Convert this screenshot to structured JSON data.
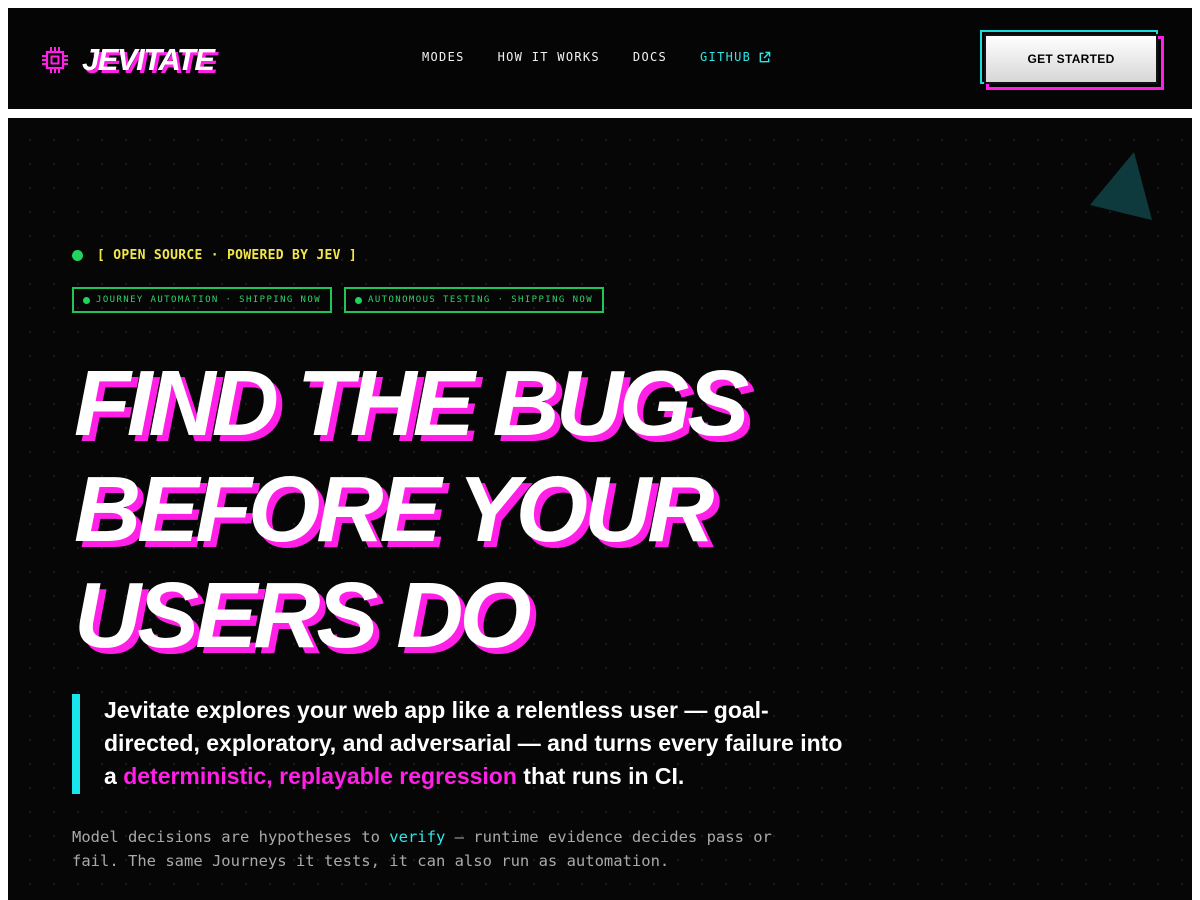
{
  "nav": {
    "logo_text": "JEVITATE",
    "logo_icon": "chip-icon",
    "links": [
      {
        "label": "MODES"
      },
      {
        "label": "HOW IT WORKS"
      },
      {
        "label": "DOCS"
      },
      {
        "label": "GITHUB",
        "icon": "external-link-icon"
      }
    ],
    "cta_label": "GET STARTED"
  },
  "hero": {
    "eyebrow": "[ OPEN SOURCE · POWERED BY JEV ]",
    "badges": [
      {
        "label": "JOURNEY AUTOMATION · SHIPPING NOW"
      },
      {
        "label": "AUTONOMOUS TESTING · SHIPPING NOW"
      }
    ],
    "headline": [
      "FIND THE BUGS",
      "BEFORE YOUR",
      "USERS DO"
    ],
    "lede": {
      "before": "Jevitate explores your web app like a relentless user — goal-directed, exploratory, and adversarial — and turns every failure into a ",
      "highlight": "deterministic, replayable regression",
      "after": " that runs in CI."
    },
    "fine": {
      "before": "Model decisions are hypotheses to ",
      "highlight": "verify",
      "after": " — runtime evidence decides pass or fail. The same Journeys it tests, it can also run as automation."
    }
  },
  "colors": {
    "background": "#060606",
    "magenta": "#ff1fe6",
    "cyan": "#17e7ec",
    "green": "#22c45a",
    "yellow": "#f1e64a"
  }
}
